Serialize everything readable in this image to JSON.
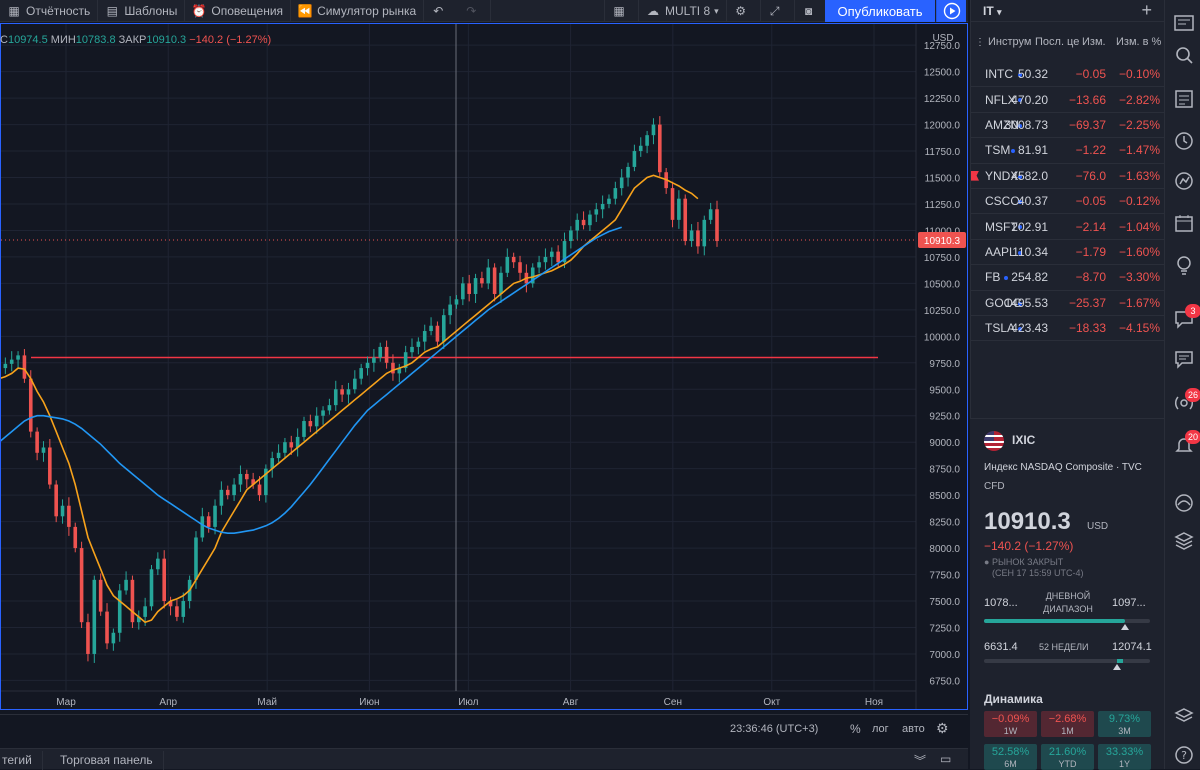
{
  "toolbar": {
    "reports_label": "Отчётность",
    "templates_label": "Шаблоны",
    "alerts_label": "Оповещения",
    "simulator_label": "Симулятор рынка",
    "layout_label": "MULTI 8",
    "publish_label": "Опубликовать"
  },
  "legend": {
    "prefix": "C",
    "close_prefix_val": "10974.5",
    "low_label": "МИН",
    "low_val": "10783.8",
    "close_label": "ЗАКР",
    "close_val": "10910.3",
    "change": "−140.2 (−1.27%)"
  },
  "price_axis": {
    "currency": "USD",
    "current_price": "10910.3",
    "ticks": [
      "12750.0",
      "12500.0",
      "12250.0",
      "12000.0",
      "11750.0",
      "11500.0",
      "11250.0",
      "11000.0",
      "10750.0",
      "10500.0",
      "10250.0",
      "10000.0",
      "9750.0",
      "9500.0",
      "9250.0",
      "9000.0",
      "8750.0",
      "8500.0",
      "8250.0",
      "8000.0",
      "7750.0",
      "7500.0",
      "7250.0",
      "7000.0",
      "6750.0"
    ]
  },
  "time_axis": {
    "months": [
      "Мар",
      "Апр",
      "Май",
      "Июн",
      "Июл",
      "Авг",
      "Сен",
      "Окт",
      "Ноя"
    ]
  },
  "bottom_bar": {
    "clock": "23:36:46 (UTC+3)",
    "percent_label": "%",
    "log_label": "лог",
    "auto_label": "авто"
  },
  "bottom_tabs": {
    "strategies_label": "тегий",
    "trading_panel_label": "Торговая панель"
  },
  "watchlist": {
    "title": "IT",
    "columns": {
      "instrument": "Инструм",
      "last": "Посл. це",
      "change": "Изм.",
      "change_pct": "Изм. в %"
    },
    "rows": [
      {
        "sym": "INTC",
        "last": "50.32",
        "chg": "−0.05",
        "pct": "−0.10%"
      },
      {
        "sym": "NFLX",
        "last": "470.20",
        "chg": "−13.66",
        "pct": "−2.82%"
      },
      {
        "sym": "AMZN",
        "last": "3008.73",
        "chg": "−69.37",
        "pct": "−2.25%"
      },
      {
        "sym": "TSM",
        "last": "81.91",
        "chg": "−1.22",
        "pct": "−1.47%"
      },
      {
        "sym": "YNDX",
        "last": "4582.0",
        "chg": "−76.0",
        "pct": "−1.63%"
      },
      {
        "sym": "CSCO",
        "last": "40.37",
        "chg": "−0.05",
        "pct": "−0.12%"
      },
      {
        "sym": "MSFT",
        "last": "202.91",
        "chg": "−2.14",
        "pct": "−1.04%"
      },
      {
        "sym": "AAPL",
        "last": "110.34",
        "chg": "−1.79",
        "pct": "−1.60%"
      },
      {
        "sym": "FB",
        "last": "254.82",
        "chg": "−8.70",
        "pct": "−3.30%"
      },
      {
        "sym": "GOOG",
        "last": "1495.53",
        "chg": "−25.37",
        "pct": "−1.67%"
      },
      {
        "sym": "TSLA",
        "last": "423.43",
        "chg": "−18.33",
        "pct": "−4.15%"
      }
    ]
  },
  "details": {
    "symbol": "IXIC",
    "description": "Индекс NASDAQ Composite",
    "exchange": "TVC",
    "type": "CFD",
    "price": "10910.3",
    "currency": "USD",
    "change": "−140.2 (−1.27%)",
    "market_status": "РЫНОК ЗАКРЫТ",
    "timestamp": "(СЕН 17 15:59 UTC-4)",
    "day_low": "1078...",
    "day_range_label": "ДНЕВНОЙ ДИАПАЗОН",
    "day_high": "1097...",
    "day_range_position": 0.85,
    "week52_low": "6631.4",
    "week52_label": "52 НЕДЕЛИ",
    "week52_high": "12074.1",
    "week52_position": 0.8,
    "dynamics_label": "Динамика",
    "performance": [
      {
        "val": "−0.09%",
        "period": "1W",
        "dir": "neg"
      },
      {
        "val": "−2.68%",
        "period": "1M",
        "dir": "neg"
      },
      {
        "val": "9.73%",
        "period": "3M",
        "dir": "pos"
      },
      {
        "val": "52.58%",
        "period": "6M",
        "dir": "pos"
      },
      {
        "val": "21.60%",
        "period": "YTD",
        "dir": "pos"
      },
      {
        "val": "33.33%",
        "period": "1Y",
        "dir": "pos"
      }
    ]
  },
  "sidebar": {
    "badges": [
      "3",
      "26",
      "20"
    ]
  },
  "chart_data": {
    "type": "candlestick",
    "ylim": [
      6650,
      12950
    ],
    "hline": 9800,
    "months": [
      {
        "label": "Мар",
        "day": 0
      },
      {
        "label": "Апр",
        "day": 31
      },
      {
        "label": "Май",
        "day": 61
      },
      {
        "label": "Июн",
        "day": 92
      },
      {
        "label": "Июл",
        "day": 122
      },
      {
        "label": "Авг",
        "day": 153
      },
      {
        "label": "Сен",
        "day": 184
      },
      {
        "label": "Окт",
        "day": 214
      },
      {
        "label": "Ноя",
        "day": 245
      }
    ],
    "closes": [
      9700,
      9740,
      9780,
      9820,
      9600,
      9100,
      8900,
      8950,
      8600,
      8300,
      8400,
      8200,
      8000,
      7300,
      7000,
      7700,
      7400,
      7100,
      7200,
      7600,
      7700,
      7300,
      7350,
      7450,
      7800,
      7900,
      7500,
      7450,
      7350,
      7500,
      7700,
      8100,
      8300,
      8200,
      8400,
      8550,
      8500,
      8600,
      8700,
      8650,
      8600,
      8500,
      8750,
      8850,
      8900,
      9000,
      8950,
      9050,
      9200,
      9150,
      9250,
      9300,
      9350,
      9500,
      9450,
      9500,
      9600,
      9700,
      9750,
      9800,
      9900,
      9750,
      9650,
      9700,
      9850,
      9900,
      9950,
      10050,
      10100,
      9950,
      10200,
      10300,
      10350,
      10500,
      10400,
      10550,
      10500,
      10650,
      10400,
      10600,
      10750,
      10700,
      10600,
      10500,
      10650,
      10700,
      10750,
      10800,
      10700,
      10900,
      11000,
      11100,
      11050,
      11150,
      11200,
      11250,
      11300,
      11400,
      11500,
      11600,
      11750,
      11800,
      11900,
      12000,
      11550,
      11400,
      11100,
      11300,
      10900,
      11000,
      10850,
      11100,
      11200,
      10900
    ],
    "ema_fast": [
      9600,
      9620,
      9650,
      9700,
      9690,
      9600,
      9480,
      9380,
      9250,
      9100,
      8950,
      8800,
      8600,
      8350,
      8100,
      7950,
      7800,
      7650,
      7550,
      7500,
      7450,
      7400,
      7350,
      7300,
      7320,
      7400,
      7450,
      7500,
      7520,
      7550,
      7600,
      7700,
      7800,
      7900,
      8000,
      8150,
      8250,
      8350,
      8450,
      8550,
      8600,
      8650,
      8700,
      8750,
      8800,
      8850,
      8900,
      8950,
      9000,
      9050,
      9100,
      9150,
      9200,
      9250,
      9300,
      9350,
      9400,
      9450,
      9500,
      9550,
      9600,
      9650,
      9680,
      9700,
      9720,
      9750,
      9800,
      9850,
      9880,
      9900,
      9950,
      10000,
      10050,
      10100,
      10150,
      10200,
      10250,
      10300,
      10350,
      10400,
      10450,
      10500,
      10520,
      10550,
      10560,
      10580,
      10600,
      10620,
      10650,
      10680,
      10720,
      10780,
      10850,
      10900,
      10950,
      11000,
      11050,
      11100,
      11200,
      11300,
      11400,
      11450,
      11500,
      11520,
      11500,
      11480,
      11450,
      11420,
      11380,
      11350,
      11300
    ],
    "sma_slow": [
      9000,
      9050,
      9100,
      9150,
      9200,
      9230,
      9250,
      9250,
      9240,
      9230,
      9220,
      9200,
      9170,
      9130,
      9080,
      9030,
      8980,
      8920,
      8860,
      8800,
      8750,
      8700,
      8650,
      8600,
      8550,
      8500,
      8460,
      8420,
      8380,
      8340,
      8300,
      8260,
      8220,
      8190,
      8170,
      8150,
      8140,
      8140,
      8150,
      8160,
      8170,
      8190,
      8210,
      8240,
      8280,
      8330,
      8390,
      8460,
      8530,
      8600,
      8680,
      8760,
      8840,
      8920,
      9000,
      9080,
      9160,
      9230,
      9300,
      9350,
      9400,
      9450,
      9500,
      9550,
      9600,
      9650,
      9700,
      9750,
      9800,
      9850,
      9900,
      9950,
      10000,
      10050,
      10100,
      10150,
      10200,
      10250,
      10290,
      10330,
      10370,
      10410,
      10450,
      10490,
      10530,
      10570,
      10610,
      10650,
      10690,
      10730,
      10770,
      10810,
      10850,
      10890,
      10930,
      10960,
      10990,
      11010,
      11030
    ]
  }
}
